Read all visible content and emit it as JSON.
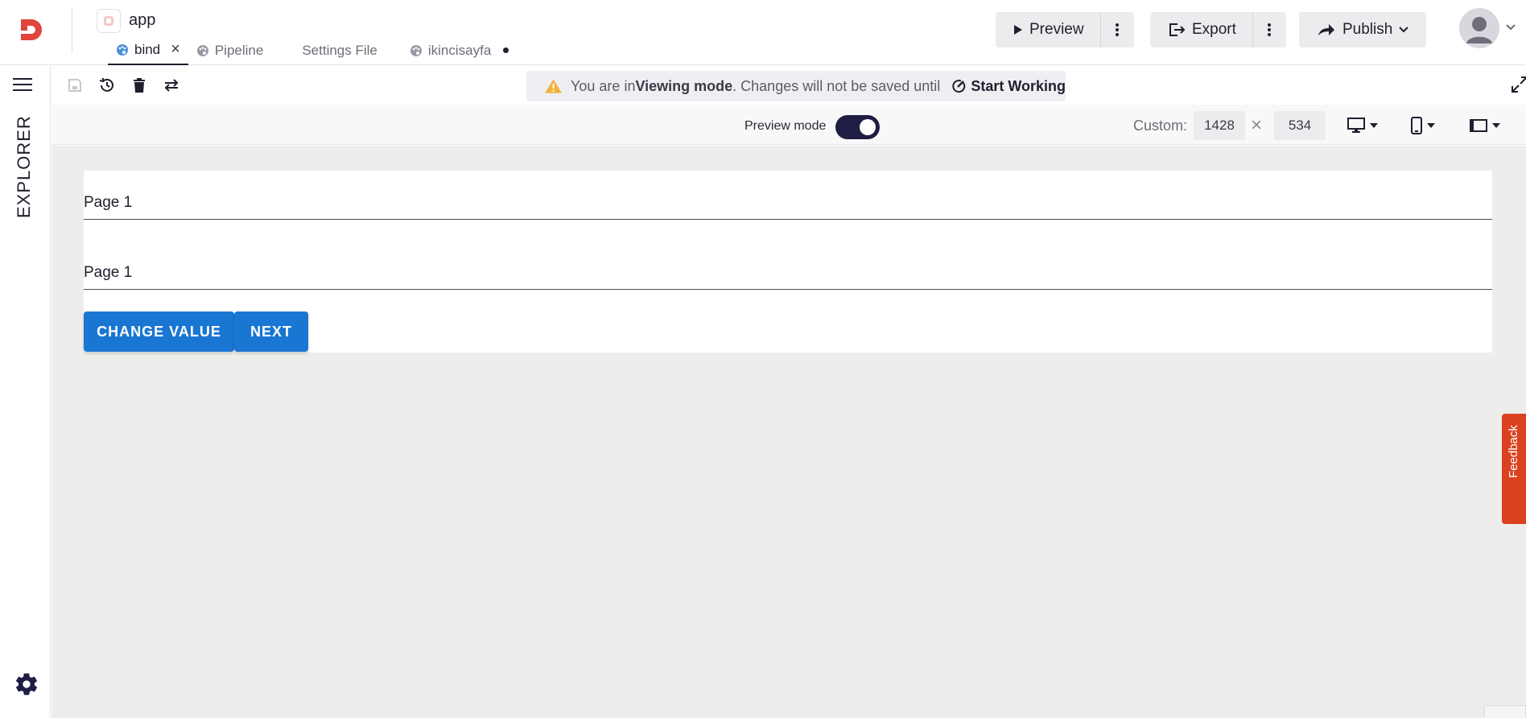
{
  "header": {
    "app_name": "app",
    "tabs": [
      {
        "label": "bind",
        "active": true,
        "closable": true
      },
      {
        "label": "Pipeline",
        "active": false
      },
      {
        "label": "Settings File",
        "active": false
      },
      {
        "label": "ikincisayfa",
        "active": false,
        "unsaved": true
      }
    ],
    "preview_label": "Preview",
    "export_label": "Export",
    "publish_label": "Publish"
  },
  "sidebar": {
    "explorer_label": "EXPLORER"
  },
  "toolbar": {
    "banner_prefix": "You are in ",
    "banner_mode": "Viewing mode",
    "banner_suffix": ". Changes will not be saved until",
    "start_working_label": "Start Working"
  },
  "preview_bar": {
    "preview_mode_label": "Preview mode",
    "preview_mode_on": true,
    "custom_label": "Custom:",
    "width_value": "1428",
    "height_value": "534"
  },
  "canvas": {
    "text_1": "Page 1",
    "text_2": "Page 1",
    "change_value_label": "CHANGE VALUE",
    "next_label": "NEXT"
  },
  "feedback_label": "Feedback",
  "colors": {
    "accent": "#1976d2",
    "toggle": "#1f1d44",
    "feedback": "#d9411f",
    "warning": "#f2b33d",
    "brand": "#e0443c"
  }
}
